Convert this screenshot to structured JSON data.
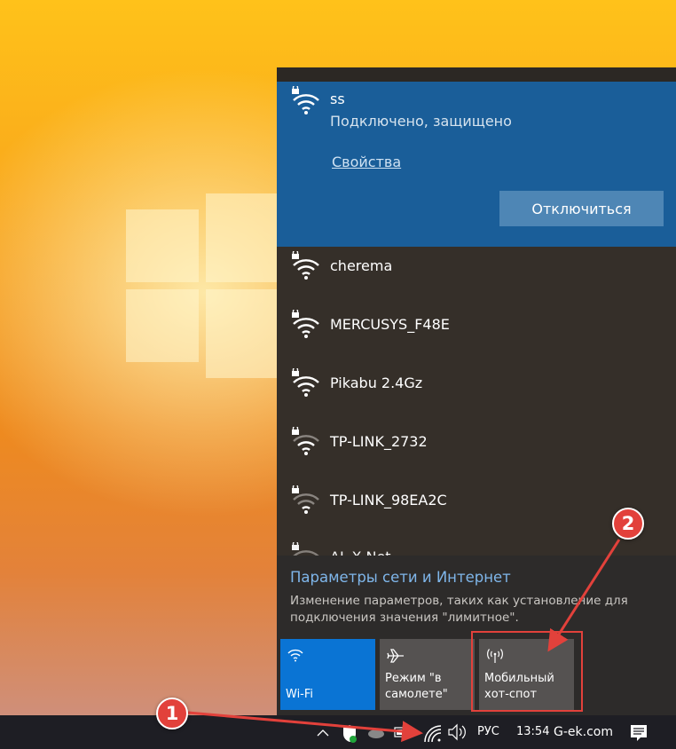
{
  "connected_network": {
    "name": "ss",
    "status": "Подключено, защищено",
    "properties_link": "Свойства",
    "disconnect_button": "Отключиться"
  },
  "networks": [
    {
      "name": "cherema",
      "icon": "wifi-secured-icon"
    },
    {
      "name": "MERCUSYS_F48E",
      "icon": "wifi-secured-icon"
    },
    {
      "name": "Pikabu 2.4Gz",
      "icon": "wifi-secured-icon"
    },
    {
      "name": "TP-LINK_2732",
      "icon": "wifi-secured-weak-icon"
    },
    {
      "name": "TP-LINK_98EA2C",
      "icon": "wifi-secured-weak-icon"
    },
    {
      "name": "AL-X-Net",
      "icon": "wifi-secured-weak-icon"
    }
  ],
  "settings": {
    "title": "Параметры сети и Интернет",
    "description": "Изменение параметров, таких как установление для подключения значения \"лимитное\"."
  },
  "quick_actions": {
    "wifi": "Wi-Fi",
    "airplane": "Режим \"в самолете\"",
    "hotspot": "Мобильный хот-спот"
  },
  "taskbar": {
    "language": "РУС",
    "time": "13:54",
    "watermark": "G-ek.com"
  },
  "callouts": {
    "one": "1",
    "two": "2"
  },
  "colors": {
    "accent": "#0a74d4",
    "connected_bg": "#1a5e99",
    "annotation_red": "#e2413b"
  }
}
